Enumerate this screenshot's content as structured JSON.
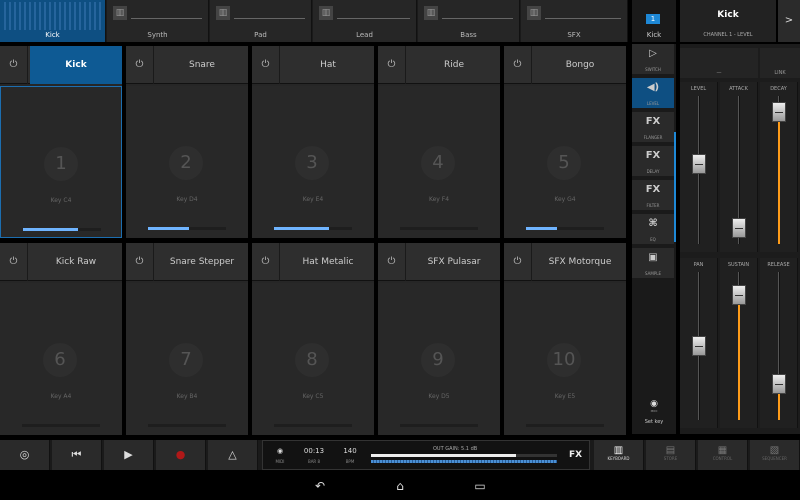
{
  "tracks": [
    {
      "label": "Kick",
      "active": true
    },
    {
      "label": "Synth",
      "active": false
    },
    {
      "label": "Pad",
      "active": false
    },
    {
      "label": "Lead",
      "active": false
    },
    {
      "label": "Bass",
      "active": false
    },
    {
      "label": "SFX",
      "active": false
    }
  ],
  "channel_box": {
    "number": "1",
    "label": "Kick"
  },
  "instrument_header": {
    "title": "Kick",
    "subtitle": "CHANNEL 1 - LEVEL",
    "next_glyph": ">"
  },
  "pads": [
    {
      "name": "Kick",
      "number": "1",
      "key": "Key C4",
      "active": true,
      "velocity": 0.7
    },
    {
      "name": "Snare",
      "number": "2",
      "key": "Key D4",
      "active": false,
      "velocity": 0.52
    },
    {
      "name": "Hat",
      "number": "3",
      "key": "Key E4",
      "active": false,
      "velocity": 0.7
    },
    {
      "name": "Ride",
      "number": "4",
      "key": "Key F4",
      "active": false,
      "velocity": 0
    },
    {
      "name": "Bongo",
      "number": "5",
      "key": "Key G4",
      "active": false,
      "velocity": 0.4
    },
    {
      "name": "Kick Raw",
      "number": "6",
      "key": "Key A4",
      "active": false,
      "velocity": 0
    },
    {
      "name": "Snare Stepper",
      "number": "7",
      "key": "Key B4",
      "active": false,
      "velocity": 0
    },
    {
      "name": "Hat Metalic",
      "number": "8",
      "key": "Key C5",
      "active": false,
      "velocity": 0
    },
    {
      "name": "SFX Pulasar",
      "number": "9",
      "key": "Key D5",
      "active": false,
      "velocity": 0
    },
    {
      "name": "SFX Motorque",
      "number": "10",
      "key": "Key E5",
      "active": false,
      "velocity": 0
    }
  ],
  "fx_column": [
    {
      "icon": "▷",
      "label": "SWITCH",
      "active": false
    },
    {
      "icon": "◀)",
      "label": "LEVEL",
      "active": true
    },
    {
      "icon": "FX",
      "label": "FLANGER",
      "active": false
    },
    {
      "icon": "FX",
      "label": "DELAY",
      "active": false
    },
    {
      "icon": "FX",
      "label": "FILTER",
      "active": false
    },
    {
      "icon": "⌘",
      "label": "EQ",
      "active": false
    },
    {
      "icon": "▣",
      "label": "SAMPLE",
      "active": false
    }
  ],
  "set_key": {
    "label": "Set key",
    "icon_label": "MIDI"
  },
  "mixer": {
    "link_label": "LINK",
    "faders": [
      {
        "label": "LEVEL",
        "value": 0.55,
        "orange": false
      },
      {
        "label": "ATTACK",
        "value": 0.05,
        "orange": false
      },
      {
        "label": "DECAY",
        "value": 0.95,
        "orange": true
      },
      {
        "label": "PAN",
        "value": 0.5,
        "orange": false
      },
      {
        "label": "SUSTAIN",
        "value": 0.9,
        "orange": true
      },
      {
        "label": "RELEASE",
        "value": 0.2,
        "orange": true
      }
    ]
  },
  "transport": {
    "buttons": [
      {
        "name": "settings-button",
        "glyph": "◎"
      },
      {
        "name": "rewind-button",
        "glyph": "⏮"
      },
      {
        "name": "play-button",
        "glyph": "▶"
      },
      {
        "name": "record-button",
        "glyph": "●"
      },
      {
        "name": "metronome-button",
        "glyph": "△"
      }
    ],
    "display": {
      "time": "00:13",
      "bar": "BAR 8",
      "bpm": "140",
      "bpm_label": "BPM",
      "midi_label": "MIDI",
      "out_gain": "OUT GAIN: 5.1 dB",
      "fx": "FX"
    },
    "views": [
      {
        "label": "KEYBOARD",
        "icon": "▥",
        "active": true
      },
      {
        "label": "STORE",
        "icon": "▤",
        "active": false
      },
      {
        "label": "CONTROL",
        "icon": "▦",
        "active": false
      },
      {
        "label": "SEQUENCER",
        "icon": "▧",
        "active": false
      }
    ]
  },
  "android_nav": {
    "back": "↶",
    "home": "⌂",
    "recents": "▭"
  },
  "colors": {
    "accent": "#0e5a94",
    "velocity": "#6fb4ff",
    "fader_orange": "#ff9c19"
  }
}
